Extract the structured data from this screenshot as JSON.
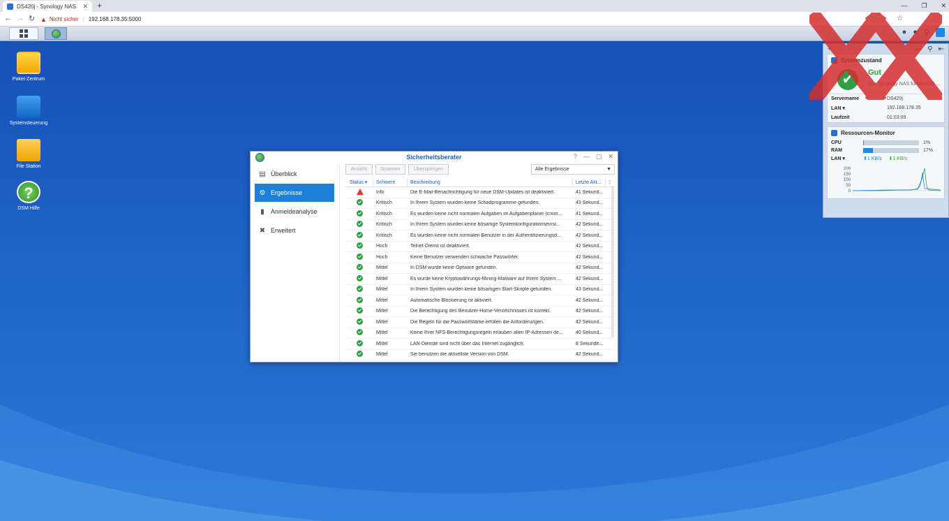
{
  "browser": {
    "tab_title": "DS420j - Synology NAS",
    "tab_close": "✕",
    "new_tab": "+",
    "window_controls": [
      "—",
      "❐",
      "✕"
    ],
    "back": "←",
    "forward": "→",
    "reload": "↻",
    "warning_icon": "▲",
    "not_secure": "Nicht sicher",
    "url": "192.168.178.35:5000",
    "star": "☆",
    "menu": "⋮"
  },
  "desktop": {
    "icons": [
      {
        "label": "Paket-Zentrum"
      },
      {
        "label": "Systemsteuerung"
      },
      {
        "label": "File Station"
      },
      {
        "label": "DSM Hilfe"
      }
    ]
  },
  "widgets": {
    "header_add": "+",
    "header_icons": [
      "—",
      "⚲",
      "⇤"
    ],
    "system_status": {
      "title": "Systemzustand",
      "status": "Gut",
      "subtitle": "Ihre Synology NAS funktioniert ...",
      "rows": [
        {
          "key": "Servername",
          "value": "DS420j"
        },
        {
          "key": "LAN ▾",
          "value": "192.168.178.35"
        },
        {
          "key": "Laufzeit",
          "value": "01:03:09"
        }
      ]
    },
    "resource_monitor": {
      "title": "Ressourcen-Monitor",
      "cpu_label": "CPU",
      "cpu_pct": "1%",
      "cpu_value": 0.01,
      "ram_label": "RAM",
      "ram_pct": "17%",
      "ram_value": 0.17,
      "lan_label": "LAN ▾",
      "lan_up": "⬆1 KB/s",
      "lan_down": "⬇1 KB/s",
      "graph_ticks": [
        "200",
        "150",
        "100",
        "50",
        "0"
      ]
    }
  },
  "window": {
    "title": "Sicherheitsberater",
    "controls": [
      "?",
      "—",
      "▢",
      "✕"
    ],
    "sidebar": [
      {
        "label": "Überblick",
        "icon": "▤",
        "active": false
      },
      {
        "label": "Ergebnisse",
        "icon": "⚙",
        "active": true
      },
      {
        "label": "Anmeldeanalyse",
        "icon": "▮",
        "active": false
      },
      {
        "label": "Erweitert",
        "icon": "✖",
        "active": false
      }
    ],
    "toolbar": {
      "view": "Ansicht",
      "scan": "Scannen",
      "skip": "Überspringen",
      "filter": "Alle Ergebnisse",
      "filter_caret": "▼"
    },
    "table": {
      "headers": [
        "Status ▾",
        "Schwere",
        "Beschreibung",
        "Letzte Akt...",
        "⋮"
      ],
      "rows": [
        {
          "status": "warn",
          "severity": "Info",
          "desc": "Die E-Mail-Benachrichtigung für neue DSM-Updates ist deaktiviert.",
          "last": "41 Sekund..."
        },
        {
          "status": "ok",
          "severity": "Kritisch",
          "desc": "In Ihrem System wurden keine Schadprogramme gefunden.",
          "last": "43 Sekund..."
        },
        {
          "status": "ok",
          "severity": "Kritisch",
          "desc": "Es wurden keine nicht normalen Aufgaben im Aufgabenplaner (cront...",
          "last": "41 Sekund..."
        },
        {
          "status": "ok",
          "severity": "Kritisch",
          "desc": "In Ihrem System wurden keine bösartige Systemkonfigurationseinst...",
          "last": "42 Sekund..."
        },
        {
          "status": "ok",
          "severity": "Kritisch",
          "desc": "Es wurden keine nicht normalen Benutzer in der Authentifizierungsd...",
          "last": "42 Sekund..."
        },
        {
          "status": "ok",
          "severity": "Hoch",
          "desc": "Telnet-Dienst ist deaktiviert.",
          "last": "42 Sekund..."
        },
        {
          "status": "ok",
          "severity": "Hoch",
          "desc": "Keine Benutzer verwenden schwache Passwörter.",
          "last": "42 Sekund..."
        },
        {
          "status": "ok",
          "severity": "Mittel",
          "desc": "In DSM wurde keine Optware gefunden.",
          "last": "42 Sekund..."
        },
        {
          "status": "ok",
          "severity": "Mittel",
          "desc": "Es wurde keine Kryptowährungs-Mining-Malware auf Ihrem System ...",
          "last": "42 Sekund..."
        },
        {
          "status": "ok",
          "severity": "Mittel",
          "desc": "In Ihrem System wurden keine bösartigen Start-Skripte gefunden.",
          "last": "43 Sekund..."
        },
        {
          "status": "ok",
          "severity": "Mittel",
          "desc": "Automatische Blockierung ist aktiviert.",
          "last": "42 Sekund..."
        },
        {
          "status": "ok",
          "severity": "Mittel",
          "desc": "Die Berechtigung des Benutzer-Home-Verzeichnisses ist korrekt.",
          "last": "42 Sekund..."
        },
        {
          "status": "ok",
          "severity": "Mittel",
          "desc": "Die Regeln für die Passwortstärke erfüllen die Anforderungen.",
          "last": "42 Sekund..."
        },
        {
          "status": "ok",
          "severity": "Mittel",
          "desc": "Keine Ihrer NFS-Berechtigungsregeln erlauben allen IP-Adressen de...",
          "last": "40 Sekund..."
        },
        {
          "status": "ok",
          "severity": "Mittel",
          "desc": "LAN-Dienste sind nicht über das Internet zugänglich.",
          "last": "8 Sekunde..."
        },
        {
          "status": "ok",
          "severity": "Mittel",
          "desc": "Sie benutzen die aktuellste Version von DSM.",
          "last": "42 Sekund..."
        }
      ]
    }
  },
  "colors": {
    "desktop": "#1a5cc4",
    "accent": "#1e7fdb",
    "ok": "#2ea043",
    "warn": "#e53935"
  }
}
